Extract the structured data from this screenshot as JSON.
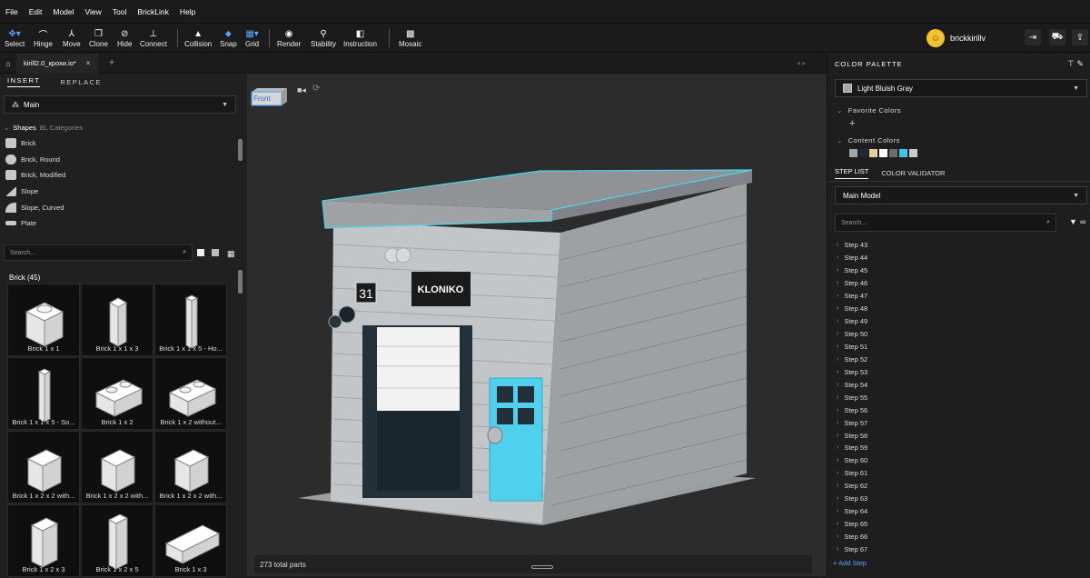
{
  "menu": {
    "items": [
      "File",
      "Edit",
      "Model",
      "View",
      "Tool",
      "BrickLink",
      "Help"
    ]
  },
  "toolbar": {
    "select": "Select",
    "hinge": "Hinge",
    "move": "Move",
    "clone": "Clone",
    "hide": "Hide",
    "connect": "Connect",
    "collision": "Collision",
    "snap": "Snap",
    "grid": "Grid",
    "render": "Render",
    "stability": "Stability",
    "instruction": "Instruction",
    "mosaic": "Mosaic"
  },
  "user": {
    "name": "brickkirillv"
  },
  "tabs": {
    "doc_title": "kirill2.0_крохи.io*",
    "add": "+"
  },
  "left": {
    "insert": "INSERT",
    "replace": "REPLACE",
    "main_select": "Main",
    "shapes": "Shapes",
    "bl_categories": "BL Categories",
    "shapes_list": [
      "Brick",
      "Brick, Round",
      "Brick, Modified",
      "Slope",
      "Slope, Curved",
      "Plate"
    ],
    "search_placeholder": "Search...",
    "group_title": "Brick (45)",
    "parts": [
      "Brick 1 x 1",
      "Brick 1 x 1 x 3",
      "Brick 1 x 1 x 5 - Ho...",
      "Brick 1 x 1 x 5 - So...",
      "Brick 1 x 2",
      "Brick 1 x 2 without...",
      "Brick 1 x 2 x 2 with...",
      "Brick 1 x 2 x 2 with...",
      "Brick 1 x 2 x 2 with...",
      "Brick 1 x 2 x 3",
      "Brick 1 x 2 x 5",
      "Brick 1 x 3"
    ]
  },
  "view": {
    "front_label": "Front",
    "parts_total": "273 total parts",
    "house_number": "31",
    "sign": "KLONIKO"
  },
  "right": {
    "color_palette": "COLOR PALETTE",
    "current_color": "Light Bluish Gray",
    "favorite_colors": "Favorite Colors",
    "content_colors": "Content Colors",
    "content_swatches": [
      "#a0a5a9",
      "#1b2a34",
      "#e4cd9e",
      "#ffffff",
      "#6c6e68",
      "#3cc6e8",
      "#c8cccf"
    ],
    "step_list": "STEP LIST",
    "color_validator": "COLOR VALIDATOR",
    "model_select": "Main Model",
    "search_placeholder": "Search...",
    "steps": [
      "Step 43",
      "Step 44",
      "Step 45",
      "Step 46",
      "Step 47",
      "Step 48",
      "Step 49",
      "Step 50",
      "Step 51",
      "Step 52",
      "Step 53",
      "Step 54",
      "Step 55",
      "Step 56",
      "Step 57",
      "Step 58",
      "Step 59",
      "Step 60",
      "Step 61",
      "Step 62",
      "Step 63",
      "Step 64",
      "Step 65",
      "Step 66",
      "Step 67"
    ],
    "add_step": "+ Add Step"
  }
}
